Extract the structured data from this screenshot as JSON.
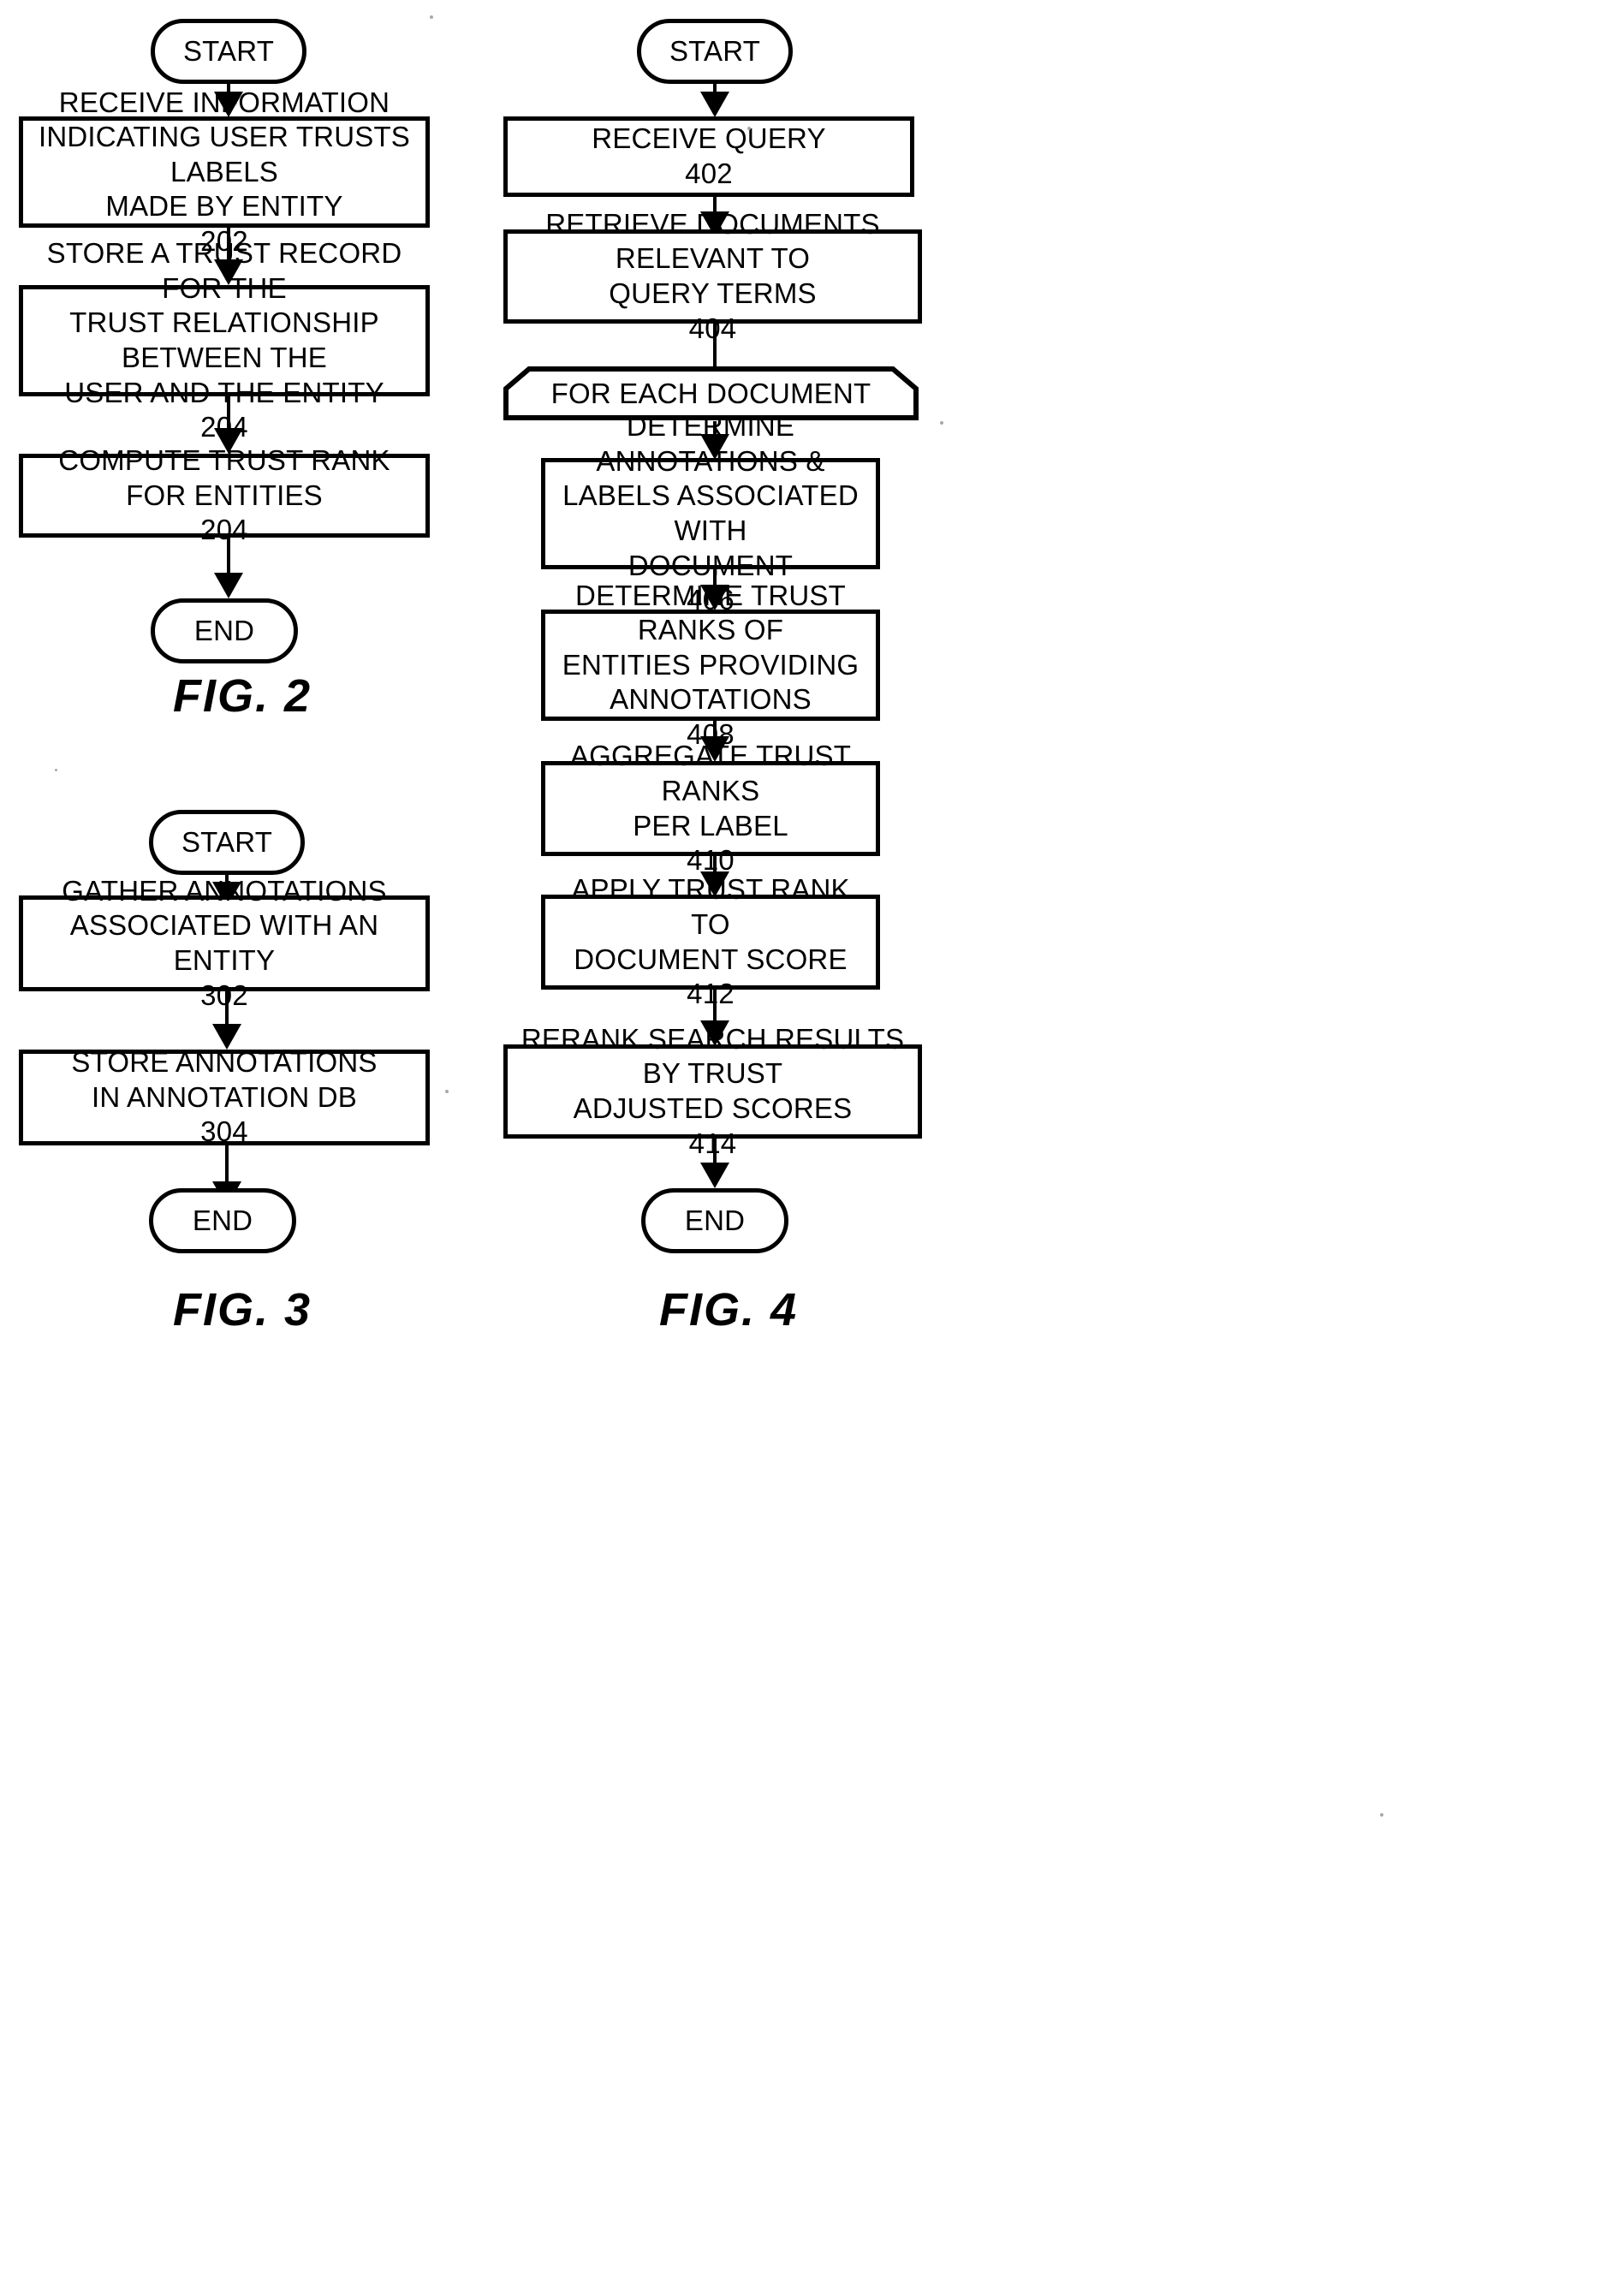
{
  "document": {
    "kind": "patent-flowchart-sheet",
    "figures": [
      "FIG. 2",
      "FIG. 3",
      "FIG. 4"
    ]
  },
  "colors": {
    "ink": "#000000",
    "paper": "#ffffff"
  },
  "fig2": {
    "caption": "FIG. 2",
    "nodes": [
      {
        "id": "fig2-start",
        "shape": "terminator",
        "text": "START"
      },
      {
        "id": "fig2-202",
        "shape": "process",
        "text": "RECEIVE INFORMATION\nINDICATING USER TRUSTS LABELS\nMADE BY ENTITY\n202",
        "ref": "202"
      },
      {
        "id": "fig2-204a",
        "shape": "process",
        "text": "STORE A TRUST RECORD FOR THE\nTRUST RELATIONSHIP BETWEEN THE\nUSER AND THE ENTITY\n204",
        "ref": "204"
      },
      {
        "id": "fig2-204b",
        "shape": "process",
        "text": "COMPUTE TRUST RANK FOR ENTITIES\n204",
        "ref": "204"
      },
      {
        "id": "fig2-end",
        "shape": "terminator",
        "text": "END"
      }
    ]
  },
  "fig3": {
    "caption": "FIG. 3",
    "nodes": [
      {
        "id": "fig3-start",
        "shape": "terminator",
        "text": "START"
      },
      {
        "id": "fig3-302",
        "shape": "process",
        "text": "GATHER ANNOTATIONS\nASSOCIATED WITH AN ENTITY\n302",
        "ref": "302"
      },
      {
        "id": "fig3-304",
        "shape": "process",
        "text": "STORE ANNOTATIONS\nIN ANNOTATION DB\n304",
        "ref": "304"
      },
      {
        "id": "fig3-end",
        "shape": "terminator",
        "text": "END"
      }
    ]
  },
  "fig4": {
    "caption": "FIG. 4",
    "nodes": [
      {
        "id": "fig4-start",
        "shape": "terminator",
        "text": "START"
      },
      {
        "id": "fig4-402",
        "shape": "process",
        "text": "RECEIVE QUERY\n402",
        "ref": "402"
      },
      {
        "id": "fig4-404",
        "shape": "process",
        "text": "RETRIEVE DOCUMENTS RELEVANT TO\nQUERY TERMS\n404",
        "ref": "404"
      },
      {
        "id": "fig4-loop",
        "shape": "loop-start",
        "text": "FOR EACH DOCUMENT"
      },
      {
        "id": "fig4-406",
        "shape": "process",
        "text": "DETERMINE ANNOTATIONS &\nLABELS ASSOCIATED WITH\nDOCUMENT\n406",
        "ref": "406"
      },
      {
        "id": "fig4-408",
        "shape": "process",
        "text": "DETERMINE TRUST RANKS OF\nENTITIES PROVIDING\nANNOTATIONS\n408",
        "ref": "408"
      },
      {
        "id": "fig4-410",
        "shape": "process",
        "text": "AGGREGATE TRUST RANKS\nPER LABEL\n410",
        "ref": "410"
      },
      {
        "id": "fig4-412",
        "shape": "process",
        "text": "APPLY TRUST RANK TO\nDOCUMENT SCORE\n412",
        "ref": "412"
      },
      {
        "id": "fig4-414",
        "shape": "process",
        "text": "RERANK SEARCH RESULTS BY TRUST\nADJUSTED SCORES\n414",
        "ref": "414"
      },
      {
        "id": "fig4-end",
        "shape": "terminator",
        "text": "END"
      }
    ]
  }
}
